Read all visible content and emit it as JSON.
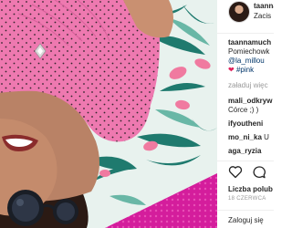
{
  "post": {
    "username": "taanna",
    "location": "Zacis"
  },
  "comments": {
    "caption_user": "taannamuch",
    "caption_line1": "Pomiechowk",
    "caption_line2": "@la_millou",
    "caption_line3": "#pink",
    "load_more": "załaduj więc",
    "c1_user": "mali_odkryw",
    "c1_text": "Córce ;) )",
    "c2_user": "ifyoutheni",
    "c3_user": "mo_ni_ka",
    "c3_text": "U",
    "c4_user": "aga_ryzia"
  },
  "footer": {
    "likes": "Liczba polub",
    "date": "18 CZERWCA",
    "login": "Zaloguj się"
  },
  "icons": {
    "heart": "heart-outline-icon",
    "comment": "comment-bubble-icon",
    "pin": "diamond-brooch"
  },
  "colors": {
    "top_pink": "#ee79b0",
    "polka_dot": "#1c1c1c",
    "blanket_magenta": "#d41d9c",
    "palm_green": "#1f7a6e",
    "flamingo_pink": "#f07aa0",
    "text_dark": "#262626",
    "link_blue": "#003569",
    "muted_gray": "#999999"
  }
}
